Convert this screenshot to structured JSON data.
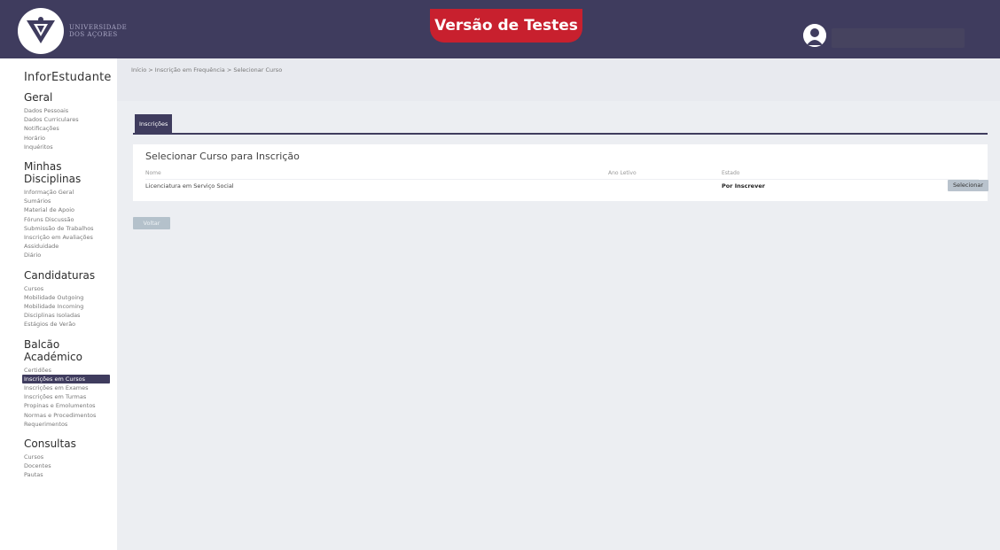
{
  "header": {
    "logo_text": "UNIVERSIDADE\nDOS AÇORES",
    "banner": "Versão de Testes"
  },
  "sidebar": {
    "app_title": "InforEstudante",
    "sections": [
      {
        "title": "Geral",
        "items": [
          "Dados Pessoais",
          "Dados Curriculares",
          "Notificações",
          "Horário",
          "Inquéritos"
        ]
      },
      {
        "title": "Minhas Disciplinas",
        "items": [
          "Informação Geral",
          "Sumários",
          "Material de Apoio",
          "Fóruns Discussão",
          "Submissão de Trabalhos",
          "Inscrição em Avaliações",
          "Assiduidade",
          "Diário"
        ]
      },
      {
        "title": "Candidaturas",
        "items": [
          "Cursos",
          "Mobilidade Outgoing",
          "Mobilidade Incoming",
          "Disciplinas Isoladas",
          "Estágios de Verão"
        ]
      },
      {
        "title": "Balcão Académico",
        "items": [
          "Certidões",
          "Inscrições em Cursos",
          "Inscrições em Exames",
          "Inscrições em Turmas",
          "Propinas e Emolumentos",
          "Normas e Procedimentos",
          "Requerimentos"
        ]
      },
      {
        "title": "Consultas",
        "items": [
          "Cursos",
          "Docentes",
          "Pautas"
        ]
      }
    ]
  },
  "breadcrumb": "Início > Inscrição em Frequência > Selecionar Curso",
  "tab": "Inscrições",
  "card": {
    "title": "Selecionar Curso para Inscrição",
    "headers": [
      "Nome",
      "Ano Letivo",
      "Estado"
    ],
    "row": {
      "name": "Licenciatura em Serviço Social",
      "year": "",
      "status": "Por Inscrever",
      "action": "Selecionar"
    }
  },
  "back_label": "Voltar"
}
